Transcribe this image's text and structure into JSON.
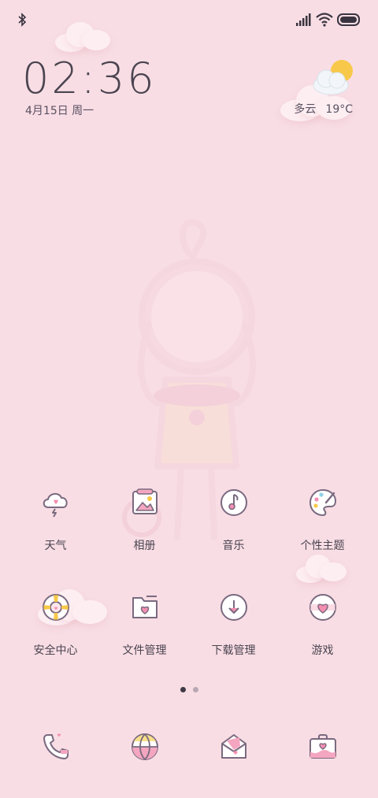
{
  "status_bar": {
    "left_icon": "bluetooth-icon",
    "right_icons": [
      "signal-icon",
      "wifi-icon",
      "battery-icon"
    ]
  },
  "clock": {
    "time": "02:36",
    "date": "4月15日 周一"
  },
  "weather": {
    "condition": "多云",
    "temperature": "19°C",
    "icon": "partly-cloudy-icon"
  },
  "apps_row1": [
    {
      "label": "天气",
      "icon": "weather-cloud-icon"
    },
    {
      "label": "相册",
      "icon": "photo-album-icon"
    },
    {
      "label": "音乐",
      "icon": "music-note-icon"
    },
    {
      "label": "个性主题",
      "icon": "palette-icon"
    }
  ],
  "apps_row2": [
    {
      "label": "安全中心",
      "icon": "lifebuoy-icon"
    },
    {
      "label": "文件管理",
      "icon": "folder-heart-icon"
    },
    {
      "label": "下载管理",
      "icon": "download-icon"
    },
    {
      "label": "游戏",
      "icon": "heart-ball-icon"
    }
  ],
  "page_indicator": {
    "active": 1,
    "count": 2
  },
  "dock": [
    {
      "icon": "phone-icon"
    },
    {
      "icon": "browser-ball-icon"
    },
    {
      "icon": "message-envelope-icon"
    },
    {
      "icon": "toolbox-heart-icon"
    }
  ],
  "colors": {
    "background": "#f8dde4",
    "accent_pink": "#f4a6c0",
    "icon_stroke": "#7a6a80",
    "sun": "#f8c84a"
  }
}
